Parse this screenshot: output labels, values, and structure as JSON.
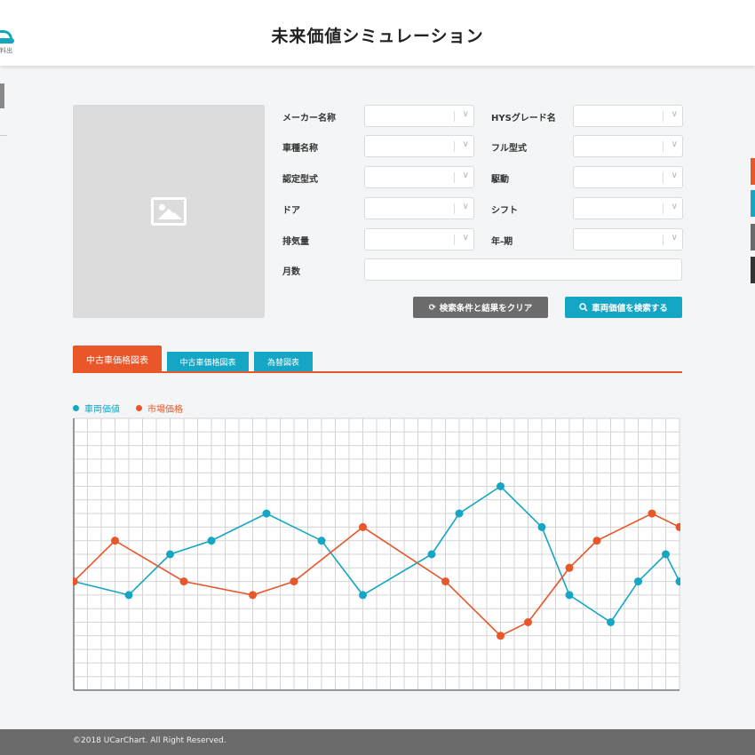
{
  "header": {
    "title": "未来価値シミュレーション",
    "logo_text": "料出"
  },
  "filters": {
    "maker_label": "メーカー名称",
    "hys_grade_label": "HYSグレード名",
    "model_label": "車種名称",
    "full_type_label": "フル型式",
    "cert_type_label": "認定型式",
    "drive_label": "駆動",
    "door_label": "ドア",
    "shift_label": "シフト",
    "displacement_label": "排気量",
    "year_label": "年-期",
    "months_label": "月数"
  },
  "buttons": {
    "clear": "検索条件と結果をクリア",
    "search": "車両価値を検索する"
  },
  "tabs": [
    "中古車価格図表",
    "中古車価格図表",
    "為替図表"
  ],
  "legend": {
    "series1": "車両価値",
    "series2": "市場価格"
  },
  "footer": {
    "copyright": "©2018 UCarChart. All Right Reserved."
  },
  "colors": {
    "teal": "#14a6c4",
    "orange": "#e8562a",
    "gray": "#6b6b6b"
  },
  "icons": {
    "clear": "refresh-icon",
    "search": "search-icon",
    "photo": "image-placeholder-icon"
  },
  "chart_data": {
    "type": "line",
    "x": [
      0,
      3,
      5,
      7,
      10,
      13,
      14,
      16,
      18,
      19,
      21,
      22,
      24,
      26,
      28,
      29,
      30,
      31,
      34,
      35,
      36,
      39,
      42,
      43,
      44
    ],
    "ylim": [
      0,
      20
    ],
    "grid": true,
    "series": [
      {
        "name": "車両価値",
        "color": "#14a6c4",
        "points": [
          [
            0,
            8
          ],
          [
            4,
            7
          ],
          [
            7,
            10
          ],
          [
            10,
            11
          ],
          [
            14,
            13
          ],
          [
            18,
            11
          ],
          [
            21,
            7
          ],
          [
            26,
            10
          ],
          [
            28,
            13
          ],
          [
            31,
            15
          ],
          [
            34,
            12
          ],
          [
            36,
            7
          ],
          [
            39,
            5
          ],
          [
            41,
            8
          ],
          [
            43,
            10
          ],
          [
            44,
            8
          ]
        ]
      },
      {
        "name": "市場価格",
        "color": "#e8562a",
        "points": [
          [
            0,
            8
          ],
          [
            3,
            11
          ],
          [
            8,
            8
          ],
          [
            13,
            7
          ],
          [
            16,
            8
          ],
          [
            21,
            12
          ],
          [
            27,
            8
          ],
          [
            31,
            4
          ],
          [
            33,
            5
          ],
          [
            36,
            9
          ],
          [
            38,
            11
          ],
          [
            42,
            13
          ],
          [
            44,
            12
          ]
        ]
      }
    ]
  }
}
